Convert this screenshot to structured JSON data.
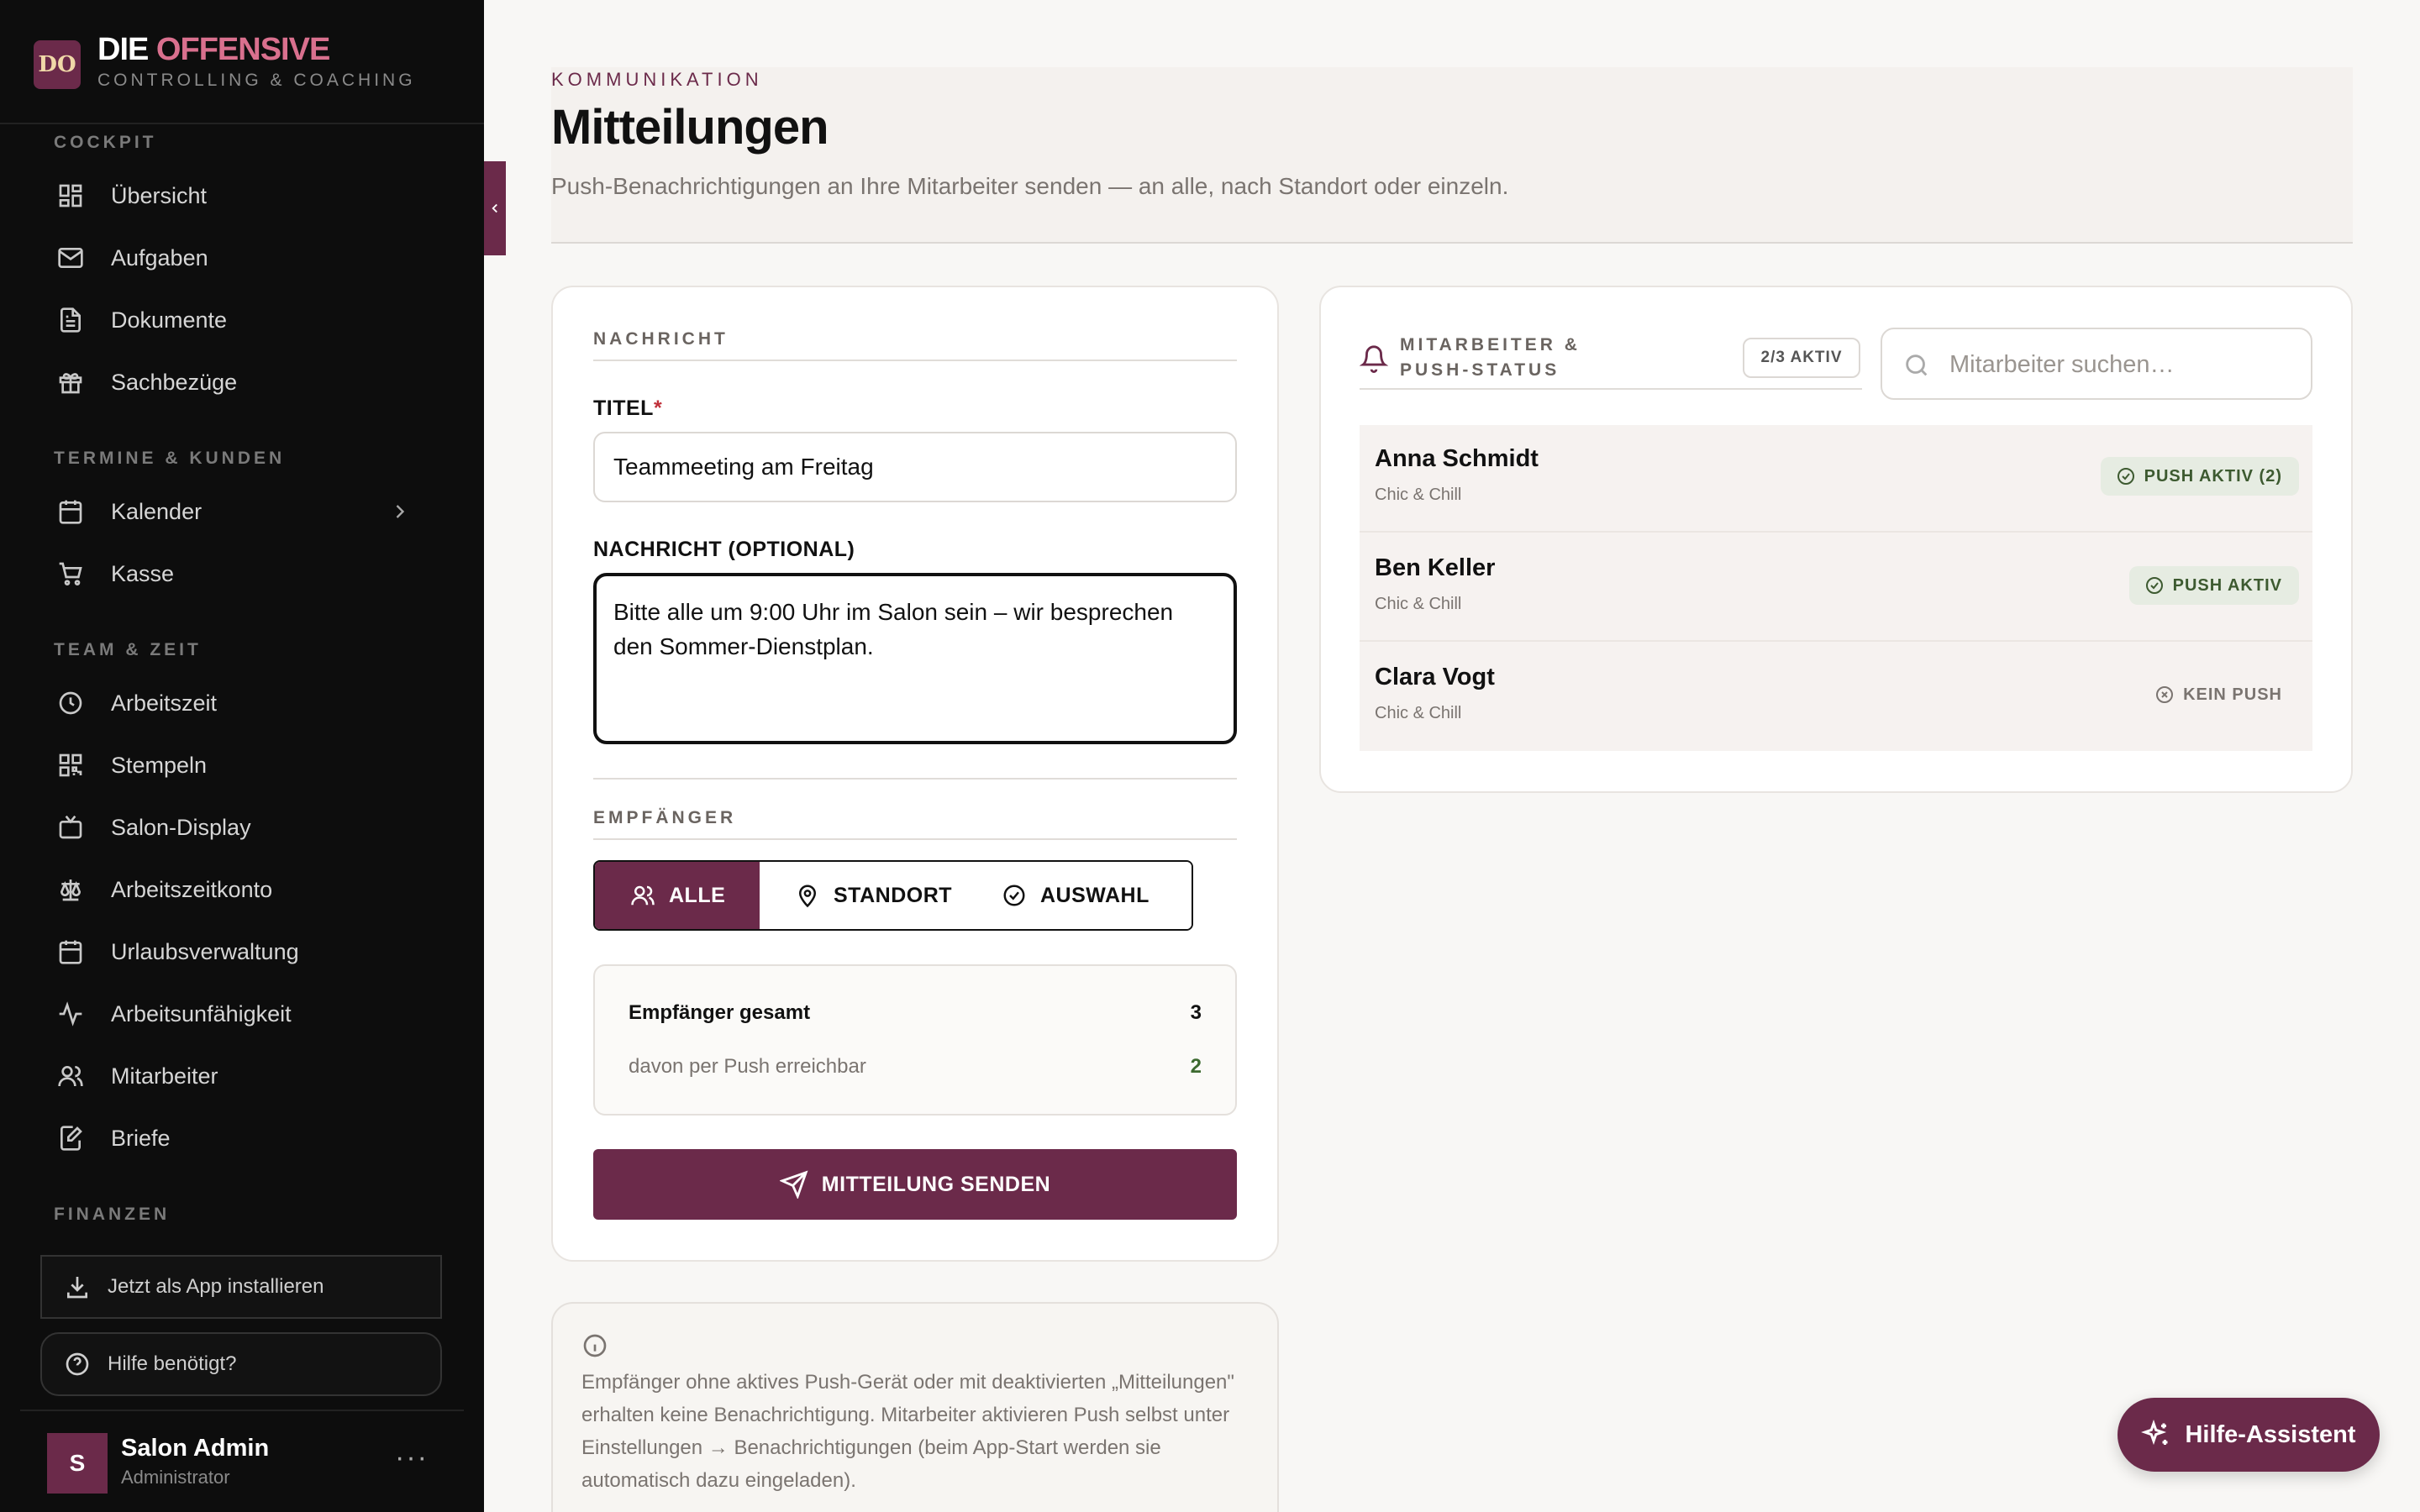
{
  "brand": {
    "logo": "DO",
    "title_part1": "DIE",
    "title_part2": "OFFENSIVE",
    "subtitle": "CONTROLLING & COACHING",
    "accent_color": "#6b2a4a",
    "highlight_color": "#d9708e"
  },
  "sidebar": {
    "sections": [
      {
        "label": "COCKPIT"
      },
      {
        "label": "TERMINE & KUNDEN"
      },
      {
        "label": "TEAM & ZEIT"
      },
      {
        "label": "FINANZEN"
      }
    ],
    "items": [
      {
        "label": "Übersicht",
        "icon": "dashboard-icon"
      },
      {
        "label": "Aufgaben",
        "icon": "mail-icon"
      },
      {
        "label": "Dokumente",
        "icon": "document-icon"
      },
      {
        "label": "Sachbezüge",
        "icon": "gift-icon"
      },
      {
        "label": "Kalender",
        "icon": "calendar-icon"
      },
      {
        "label": "Kasse",
        "icon": "cart-icon"
      },
      {
        "label": "Arbeitszeit",
        "icon": "clock-icon"
      },
      {
        "label": "Stempeln",
        "icon": "qr-code-icon"
      },
      {
        "label": "Salon-Display",
        "icon": "tv-icon"
      },
      {
        "label": "Arbeitszeitkonto",
        "icon": "scale-icon"
      },
      {
        "label": "Urlaubsverwaltung",
        "icon": "calendar-icon"
      },
      {
        "label": "Arbeitsunfähigkeit",
        "icon": "activity-icon"
      },
      {
        "label": "Mitarbeiter",
        "icon": "users-icon"
      },
      {
        "label": "Briefe",
        "icon": "edit-document-icon"
      }
    ],
    "install_label": "Jetzt als App installieren",
    "help_label": "Hilfe benötigt?",
    "user": {
      "initial": "S",
      "name": "Salon Admin",
      "role": "Administrator",
      "more": "···"
    }
  },
  "header": {
    "eyebrow": "KOMMUNIKATION",
    "title": "Mitteilungen",
    "subtitle": "Push-Benachrichtigungen an Ihre Mitarbeiter senden — an alle, nach Standort oder einzeln."
  },
  "compose": {
    "section_label": "NACHRICHT",
    "title_label": "TITEL",
    "required_mark": "*",
    "title_value": "Teammeeting am Freitag",
    "message_label": "NACHRICHT (OPTIONAL)",
    "message_value": "Bitte alle um 9:00 Uhr im Salon sein – wir besprechen den Sommer-Dienstplan.",
    "recipients_label": "EMPFÄNGER",
    "segments": [
      {
        "label": "ALLE",
        "icon": "users-icon",
        "active": true
      },
      {
        "label": "STANDORT",
        "icon": "map-pin-icon",
        "active": false
      },
      {
        "label": "AUSWAHL",
        "icon": "check-circle-icon",
        "active": false
      }
    ],
    "summary": {
      "total_label": "Empfänger gesamt",
      "total_value": "3",
      "push_label": "davon per Push erreichbar",
      "push_value": "2"
    },
    "send_label": "MITTEILUNG SENDEN"
  },
  "info": {
    "text": "Empfänger ohne aktives Push-Gerät oder mit deaktivierten „Mitteilungen\" erhalten keine Benachrichtigung. Mitarbeiter aktivieren Push selbst unter Einstellungen → Benachrichtigungen (beim App-Start werden sie automatisch dazu eingeladen)."
  },
  "employees": {
    "title": "MITARBEITER & PUSH-STATUS",
    "active_count": "2/3 AKTIV",
    "search_placeholder": "Mitarbeiter suchen…",
    "list": [
      {
        "name": "Anna Schmidt",
        "location": "Chic & Chill",
        "status": "PUSH AKTIV (2)",
        "push": true
      },
      {
        "name": "Ben Keller",
        "location": "Chic & Chill",
        "status": "PUSH AKTIV",
        "push": true
      },
      {
        "name": "Clara Vogt",
        "location": "Chic & Chill",
        "status": "KEIN PUSH",
        "push": false
      }
    ]
  },
  "help_assistant": {
    "label": "Hilfe-Assistent"
  }
}
